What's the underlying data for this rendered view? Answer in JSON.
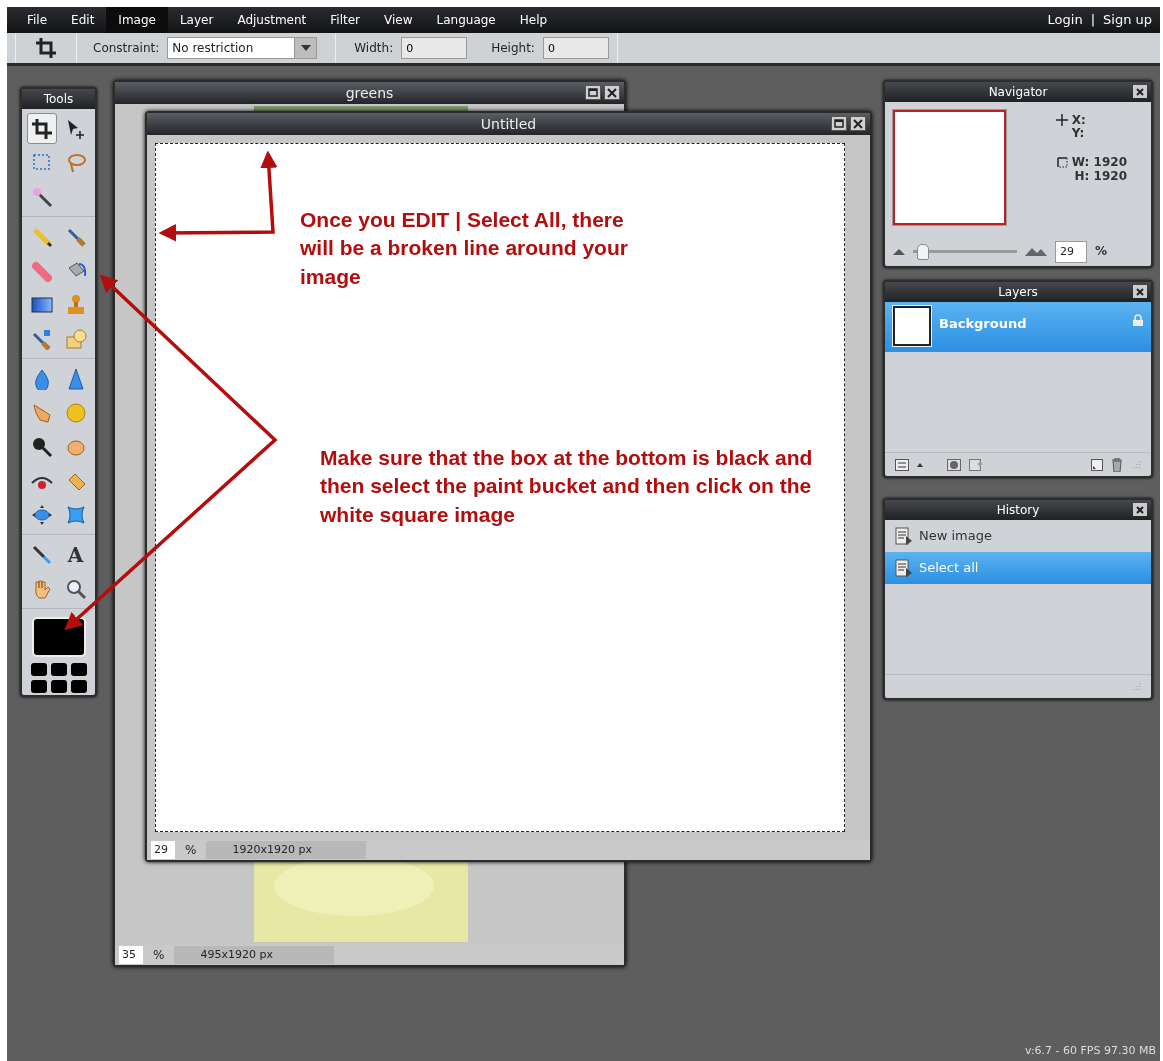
{
  "menu": [
    {
      "label": "File",
      "selected": false
    },
    {
      "label": "Edit",
      "selected": false
    },
    {
      "label": "Image",
      "selected": true
    },
    {
      "label": "Layer",
      "selected": false
    },
    {
      "label": "Adjustment",
      "selected": false
    },
    {
      "label": "Filter",
      "selected": false
    },
    {
      "label": "View",
      "selected": false
    },
    {
      "label": "Language",
      "selected": false
    },
    {
      "label": "Help",
      "selected": false
    }
  ],
  "account": {
    "login": "Login",
    "separator": "|",
    "signup": "Sign up"
  },
  "toolbar": {
    "constraint_label": "Constraint:",
    "constraint_value": "No restriction",
    "width_label": "Width:",
    "width_value": "0",
    "height_label": "Height:",
    "height_value": "0"
  },
  "tools": {
    "title": "Tools",
    "groups": [
      [
        {
          "kind": "crop",
          "selected": true
        },
        {
          "kind": "move",
          "selected": false
        },
        {
          "kind": "marquee",
          "selected": false
        },
        {
          "kind": "lasso",
          "selected": false
        },
        {
          "kind": "wand",
          "selected": false
        }
      ],
      [
        {
          "kind": "pencil",
          "selected": false
        },
        {
          "kind": "brush",
          "selected": false
        },
        {
          "kind": "eraser",
          "selected": false
        },
        {
          "kind": "bucket",
          "selected": false
        },
        {
          "kind": "gradient",
          "selected": false
        },
        {
          "kind": "stamp",
          "selected": false
        },
        {
          "kind": "replace",
          "selected": false
        },
        {
          "kind": "shapes",
          "selected": false
        }
      ],
      [
        {
          "kind": "drop",
          "selected": false
        },
        {
          "kind": "cone",
          "selected": false
        },
        {
          "kind": "finger",
          "selected": false
        },
        {
          "kind": "sponge",
          "selected": false
        },
        {
          "kind": "lens",
          "selected": false
        },
        {
          "kind": "fist",
          "selected": false
        },
        {
          "kind": "eye",
          "selected": false
        },
        {
          "kind": "bandage",
          "selected": false
        },
        {
          "kind": "bloat",
          "selected": false
        },
        {
          "kind": "pinch",
          "selected": false
        }
      ],
      [
        {
          "kind": "dropper",
          "selected": false
        },
        {
          "kind": "type",
          "selected": false,
          "glyph": "A"
        },
        {
          "kind": "hand",
          "selected": false
        },
        {
          "kind": "zoom",
          "selected": false
        }
      ]
    ]
  },
  "documents": [
    {
      "title": "greens",
      "selection": false,
      "zoom": "35",
      "zoom_unit": "%",
      "size": "495x1920 px"
    },
    {
      "title": "Untitled",
      "kind": "blank",
      "selection": true,
      "zoom": "29",
      "zoom_unit": "%",
      "size": "1920x1920 px"
    }
  ],
  "navigator": {
    "title": "Navigator",
    "x_label": "X:",
    "y_label": "Y:",
    "width": "W: 1920",
    "height": "H: 1920",
    "zoom": "29",
    "zoom_unit": "%",
    "level": 0.1
  },
  "layers": {
    "title": "Layers",
    "items": [
      {
        "name": "Background",
        "selected": true,
        "locked": true
      }
    ]
  },
  "history": {
    "title": "History",
    "items": [
      {
        "label": "New image",
        "selected": false
      },
      {
        "label": "Select all",
        "selected": true
      }
    ]
  },
  "annotations": [
    {
      "text": "Once you EDIT | Select All, there will be a broken line around your image"
    },
    {
      "text": "Make sure that the box at the bottom is black and then select the paint bucket and then click on the white square image"
    }
  ],
  "status": "v:6.7 - 60 FPS 97.30 MB"
}
